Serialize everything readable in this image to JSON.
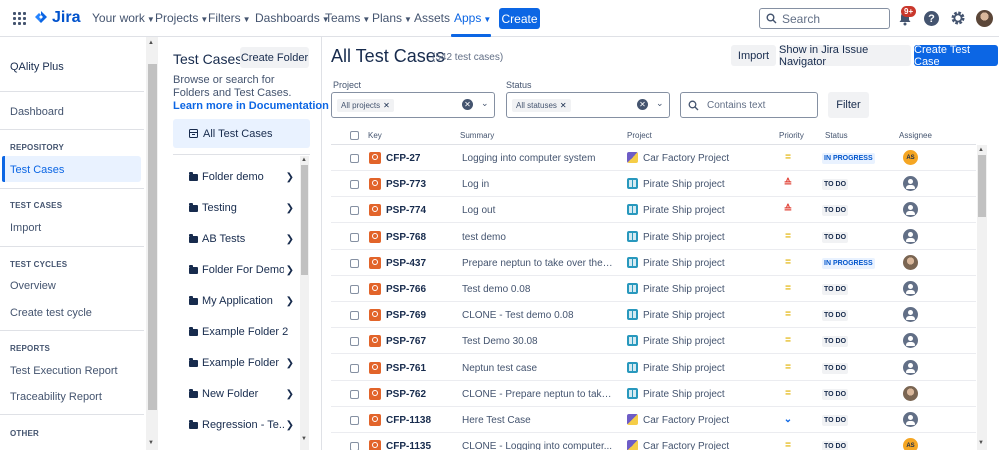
{
  "topnav": {
    "logo": "Jira",
    "items": [
      "Your work",
      "Projects",
      "Filters",
      "Dashboards",
      "Teams",
      "Plans",
      "Assets",
      "Apps"
    ],
    "create_label": "Create",
    "search_placeholder": "Search",
    "notification_count": "9+"
  },
  "sidebar": {
    "app_name": "QAlity Plus",
    "dashboard": "Dashboard",
    "sections": {
      "repository": "REPOSITORY",
      "test_cases": "TEST CASES",
      "test_cycles": "TEST CYCLES",
      "reports": "REPORTS",
      "other": "OTHER"
    },
    "items": {
      "test_cases": "Test Cases",
      "import": "Import",
      "overview": "Overview",
      "create_test_cycle": "Create test cycle",
      "test_execution_report": "Test Execution Report",
      "traceability_report": "Traceability Report"
    }
  },
  "folder_panel": {
    "title": "Test Cases",
    "create_folder_label": "Create Folder",
    "description": "Browse or search for Folders and Test Cases.",
    "learn_more": "Learn more in Documentation",
    "all_test_cases": "All Test Cases",
    "folders": [
      {
        "label": "Folder demo",
        "has_children": true
      },
      {
        "label": "Testing",
        "has_children": true
      },
      {
        "label": "AB Tests",
        "has_children": true
      },
      {
        "label": "Folder For Demo",
        "has_children": true
      },
      {
        "label": "My Application",
        "has_children": true
      },
      {
        "label": "Example Folder 2",
        "has_children": false
      },
      {
        "label": "Example Folder",
        "has_children": true
      },
      {
        "label": "New Folder",
        "has_children": true
      },
      {
        "label": "Regression - Te...",
        "has_children": true
      }
    ]
  },
  "main": {
    "title": "All Test Cases",
    "count": "(542 test cases)",
    "import_label": "Import",
    "navigator_label": "Show in Jira Issue Navigator",
    "create_test_case_label": "Create Test Case",
    "filters": {
      "project_label": "Project",
      "project_chip": "All projects",
      "status_label": "Status",
      "status_chip": "All statuses",
      "text_placeholder": "Contains text",
      "filter_button": "Filter"
    },
    "columns": [
      "Key",
      "Summary",
      "Project",
      "Priority",
      "Status",
      "Assignee"
    ],
    "rows": [
      {
        "key": "CFP-27",
        "summary": "Logging into computer system",
        "project": "Car Factory Project",
        "project_type": "car",
        "priority": "medium",
        "status": "IN PROGRESS",
        "status_type": "inprog",
        "assignee": "AS",
        "assignee_type": "init"
      },
      {
        "key": "PSP-773",
        "summary": "Log in",
        "project": "Pirate Ship project",
        "project_type": "pirate",
        "priority": "high",
        "status": "TO DO",
        "status_type": "todo",
        "assignee": "",
        "assignee_type": "default"
      },
      {
        "key": "PSP-774",
        "summary": "Log out",
        "project": "Pirate Ship project",
        "project_type": "pirate",
        "priority": "high",
        "status": "TO DO",
        "status_type": "todo",
        "assignee": "",
        "assignee_type": "default"
      },
      {
        "key": "PSP-768",
        "summary": "test demo",
        "project": "Pirate Ship project",
        "project_type": "pirate",
        "priority": "medium",
        "status": "TO DO",
        "status_type": "todo",
        "assignee": "",
        "assignee_type": "default"
      },
      {
        "key": "PSP-437",
        "summary": "Prepare neptun to take over the se...",
        "project": "Pirate Ship project",
        "project_type": "pirate",
        "priority": "medium",
        "status": "IN PROGRESS",
        "status_type": "inprog",
        "assignee": "",
        "assignee_type": "photo"
      },
      {
        "key": "PSP-766",
        "summary": "Test demo 0.08",
        "project": "Pirate Ship project",
        "project_type": "pirate",
        "priority": "medium",
        "status": "TO DO",
        "status_type": "todo",
        "assignee": "",
        "assignee_type": "default"
      },
      {
        "key": "PSP-769",
        "summary": "CLONE - Test demo 0.08",
        "project": "Pirate Ship project",
        "project_type": "pirate",
        "priority": "medium",
        "status": "TO DO",
        "status_type": "todo",
        "assignee": "",
        "assignee_type": "default"
      },
      {
        "key": "PSP-767",
        "summary": "Test Demo 30.08",
        "project": "Pirate Ship project",
        "project_type": "pirate",
        "priority": "medium",
        "status": "TO DO",
        "status_type": "todo",
        "assignee": "",
        "assignee_type": "default"
      },
      {
        "key": "PSP-761",
        "summary": "Neptun test case",
        "project": "Pirate Ship project",
        "project_type": "pirate",
        "priority": "medium",
        "status": "TO DO",
        "status_type": "todo",
        "assignee": "",
        "assignee_type": "default"
      },
      {
        "key": "PSP-762",
        "summary": "CLONE - Prepare neptun to take ov...",
        "project": "Pirate Ship project",
        "project_type": "pirate",
        "priority": "medium",
        "status": "TO DO",
        "status_type": "todo",
        "assignee": "",
        "assignee_type": "photo"
      },
      {
        "key": "CFP-1138",
        "summary": "Here Test Case",
        "project": "Car Factory Project",
        "project_type": "car",
        "priority": "low",
        "status": "TO DO",
        "status_type": "todo",
        "assignee": "",
        "assignee_type": "default"
      },
      {
        "key": "CFP-1135",
        "summary": "CLONE - Logging into computer...",
        "project": "Car Factory Project",
        "project_type": "car",
        "priority": "medium",
        "status": "TO DO",
        "status_type": "todo",
        "assignee": "AS",
        "assignee_type": "init"
      }
    ]
  },
  "colors": {
    "accent": "#0c66e4",
    "test_case_icon": "#e2642a",
    "priority_medium": "#e2b203",
    "priority_high": "#e2483d",
    "priority_low": "#0c66e4"
  }
}
